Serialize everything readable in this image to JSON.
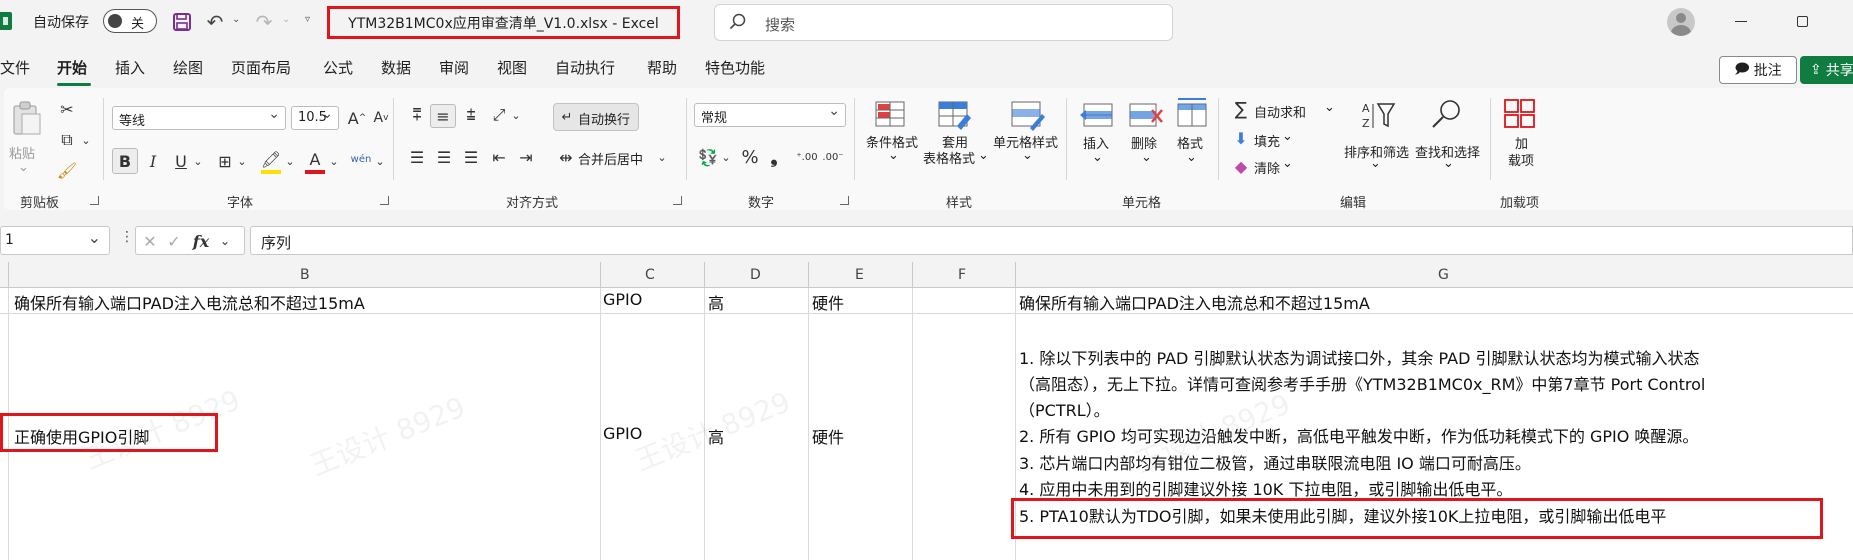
{
  "titlebar": {
    "autosave_label": "自动保存",
    "autosave_state": "关",
    "document_title": "YTM32B1MC0x应用审查清单_V1.0.xlsx  -  Excel",
    "search_placeholder": "搜索"
  },
  "tabs": [
    "文件",
    "开始",
    "插入",
    "绘图",
    "页面布局",
    "公式",
    "数据",
    "审阅",
    "视图",
    "自动执行",
    "帮助",
    "特色功能"
  ],
  "active_tab": "开始",
  "actions": {
    "comment": "批注",
    "share": "共享"
  },
  "ribbon": {
    "clipboard": {
      "paste": "粘贴",
      "group": "剪贴板"
    },
    "font": {
      "name": "等线",
      "size": "10.5",
      "group": "字体",
      "bold": "B",
      "italic": "I",
      "underline": "U",
      "phonetic": "wén"
    },
    "alignment": {
      "wrap_text": "自动换行",
      "merge_center": "合并后居中",
      "group": "对齐方式"
    },
    "number": {
      "format": "常规",
      "percent": "%",
      "comma": "❟",
      "group": "数字"
    },
    "styles": {
      "conditional": "条件格式",
      "table_format_1": "套用",
      "table_format_2": "表格格式",
      "cell_styles": "单元格样式",
      "group": "样式"
    },
    "cells": {
      "insert": "插入",
      "delete": "删除",
      "format": "格式",
      "group": "单元格"
    },
    "editing": {
      "autosum": "自动求和",
      "fill": "填充",
      "clear": "清除",
      "sort_filter": "排序和筛选",
      "find_select": "查找和选择",
      "group": "编辑"
    },
    "addins": {
      "add_1": "加",
      "add_2": "载项",
      "group": "加载项"
    }
  },
  "formula_bar": {
    "name_box": "1",
    "fx": "fx",
    "content": "序列"
  },
  "columns": [
    "B",
    "C",
    "D",
    "E",
    "F",
    "G"
  ],
  "rows": [
    {
      "b": "确保所有输入端口PAD注入电流总和不超过15mA",
      "c": "GPIO",
      "d": "高",
      "e": "硬件",
      "f": "",
      "g": [
        "确保所有输入端口PAD注入电流总和不超过15mA"
      ]
    },
    {
      "b": "正确使用GPIO引脚",
      "c": "GPIO",
      "d": "高",
      "e": "硬件",
      "f": "",
      "g": [
        "1. 除以下列表中的 PAD 引脚默认状态为调试接口外，其余 PAD 引脚默认状态均为模式输入状态",
        "（高阻态），无上下拉。详情可查阅参考手手册《YTM32B1MC0x_RM》中第7章节 Port Control",
        "（PCTRL）。",
        "2. 所有 GPIO 均可实现边沿触发中断，高低电平触发中断，作为低功耗模式下的 GPIO 唤醒源。",
        "3. 芯片端口内部均有钳位二极管，通过串联限流电阻 IO 端口可耐高压。",
        "4. 应用中未用到的引脚建议外接 10K 下拉电阻，或引脚输出低电平。",
        "5. PTA10默认为TDO引脚，如果未使用此引脚，建议外接10K上拉电阻，或引脚输出低电平"
      ]
    }
  ],
  "watermark": "王设计 8929",
  "colors": {
    "accent": "#107c41",
    "highlight_box": "#e0161c"
  }
}
